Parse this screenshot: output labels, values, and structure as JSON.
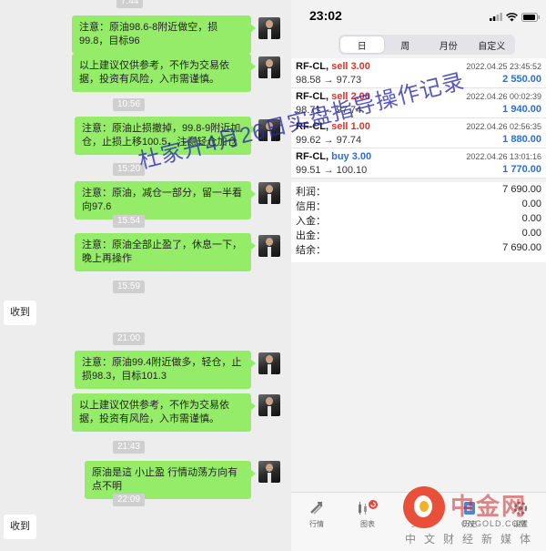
{
  "chat": {
    "top_timestamp": "7:44",
    "messages": [
      {
        "kind": "sent",
        "text": "注意：原油98.6-8附近做空，损99.8，目标96"
      },
      {
        "kind": "sent",
        "text": "以上建议仅供参考，不作为交易依据，投资有风险，入市需谨慎。"
      },
      {
        "kind": "time",
        "text": "10:56"
      },
      {
        "kind": "sent",
        "text": "注意：原油止损撤掉，99.8-9附近加仓，止损上移100.5，注意轻仓加仓"
      },
      {
        "kind": "time",
        "text": "15:20"
      },
      {
        "kind": "sent",
        "text": "注意：原油，减仓一部分，留一半看向97.6"
      },
      {
        "kind": "time",
        "text": "15:54"
      },
      {
        "kind": "sent",
        "text": "注意：原油全部止盈了，休息一下，晚上再操作"
      },
      {
        "kind": "time",
        "text": "15:59"
      },
      {
        "kind": "received",
        "text": "收到"
      },
      {
        "kind": "time",
        "text": "21:00"
      },
      {
        "kind": "sent",
        "text": "注意：原油99.4附近做多，轻仓，止损98.3，目标101.3"
      },
      {
        "kind": "sent",
        "text": "以上建议仅供参考，不作为交易依据，投资有风险，入市需谨慎。"
      },
      {
        "kind": "time",
        "text": "21:43"
      },
      {
        "kind": "sent",
        "text": "原油是這 小止盈 行情动荡方向有点不明"
      },
      {
        "kind": "time",
        "text": "22:09"
      },
      {
        "kind": "received",
        "text": "收到"
      }
    ]
  },
  "phone": {
    "clock": "23:02",
    "tabs": [
      {
        "label": "日",
        "active": true
      },
      {
        "label": "周",
        "active": false
      },
      {
        "label": "月份",
        "active": false
      },
      {
        "label": "自定义",
        "active": false
      }
    ],
    "trades": [
      {
        "symbol": "RF-CL,",
        "side": "sell 3.00",
        "side_type": "sell",
        "time": "2022.04.25 23:45:52",
        "prices": "98.58 → 97.73",
        "profit": "2 550.00"
      },
      {
        "symbol": "RF-CL,",
        "side": "sell 2.00",
        "side_type": "sell",
        "time": "2022.04.26 00:02:39",
        "prices": "98.71 → 97.74",
        "profit": "1 940.00"
      },
      {
        "symbol": "RF-CL,",
        "side": "sell 1.00",
        "side_type": "sell",
        "time": "2022.04.26 02:56:35",
        "prices": "99.62 → 97.74",
        "profit": "1 880.00"
      },
      {
        "symbol": "RF-CL,",
        "side": "buy 3.00",
        "side_type": "buy",
        "time": "2022.04.26 13:01:16",
        "prices": "99.51 → 100.10",
        "profit": "1 770.00"
      }
    ],
    "summary": [
      {
        "label": "利润：",
        "value": "7 690.00"
      },
      {
        "label": "信用：",
        "value": "0.00"
      },
      {
        "label": "入金：",
        "value": "0.00"
      },
      {
        "label": "出金：",
        "value": "0.00"
      },
      {
        "label": "结余：",
        "value": "7 690.00"
      }
    ],
    "bottom_nav": [
      {
        "label": "行情",
        "icon": "quotes-icon"
      },
      {
        "label": "图表",
        "icon": "chart-icon"
      },
      {
        "label": "交易",
        "icon": "trade-icon"
      },
      {
        "label": "历史",
        "icon": "history-icon"
      },
      {
        "label": "设置",
        "icon": "settings-icon"
      }
    ]
  },
  "watermark": "杜家升4月26日实盘指导操作记录",
  "logo": {
    "cn": "中金网",
    "en": "CNGOLD.COM",
    "tagline": "中文财经新媒体"
  },
  "colors": {
    "sent_bubble": "#95ec69",
    "sell": "#d9342b",
    "buy": "#2c6fd1",
    "watermark": "#2828aa"
  }
}
